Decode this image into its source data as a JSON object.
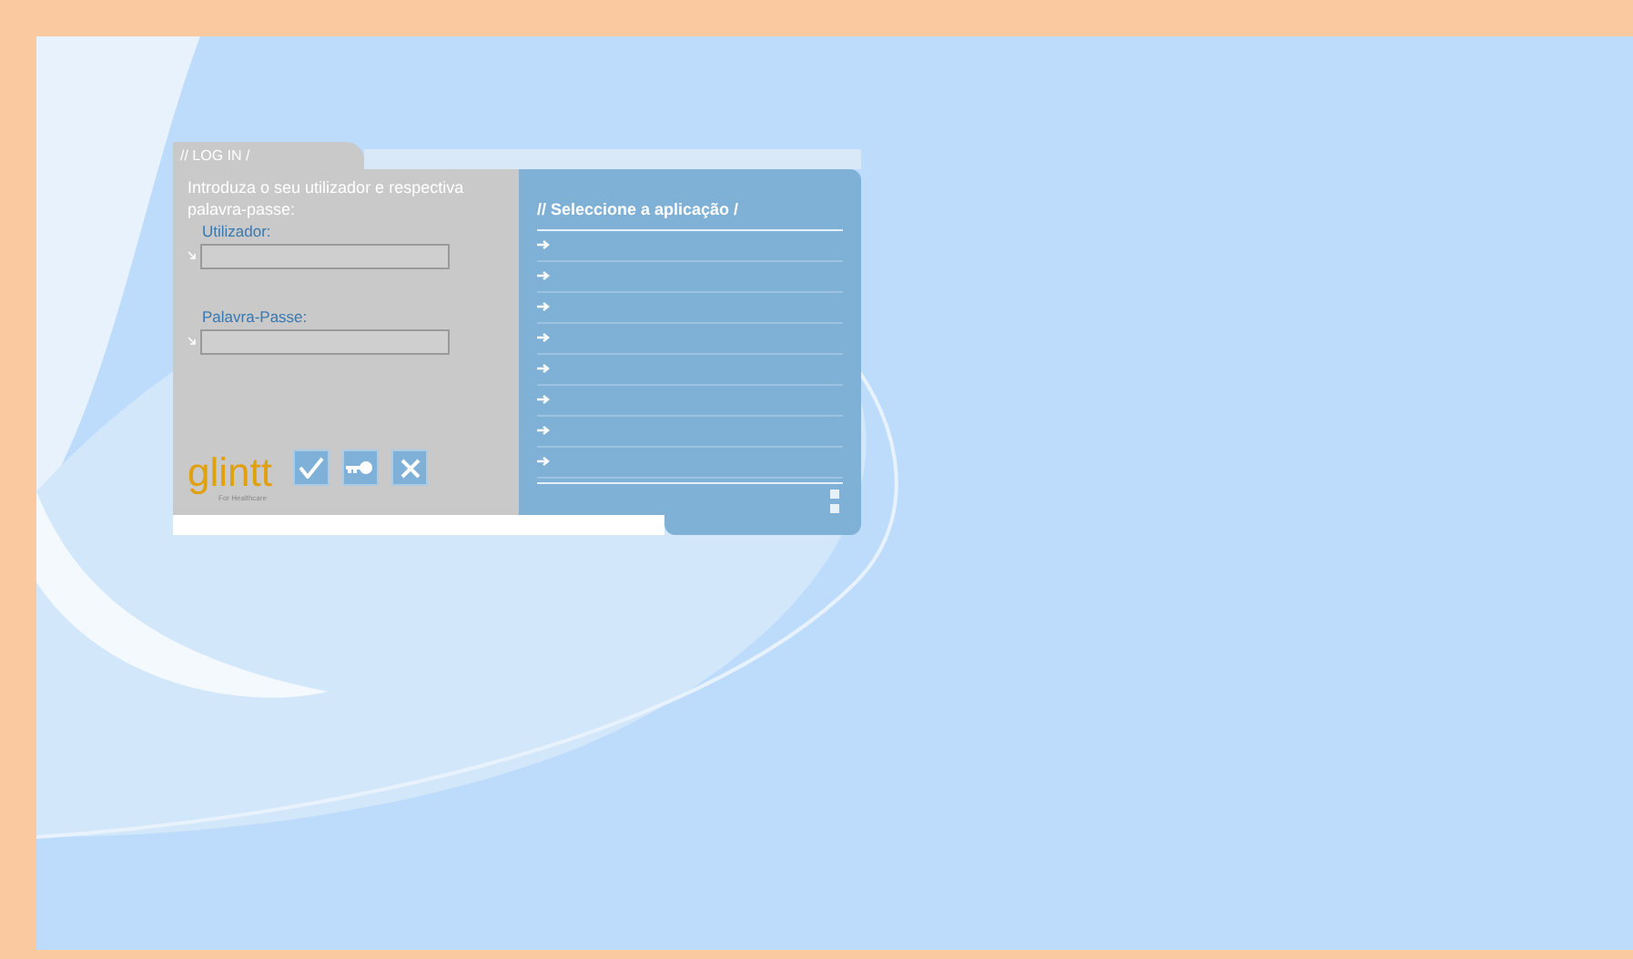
{
  "login": {
    "tab": "// LOG IN /",
    "intro": "Introduza o seu utilizador e respectiva palavra-passe:",
    "fields": [
      {
        "label": "Utilizador:"
      },
      {
        "label": "Palavra-Passe:"
      }
    ],
    "logo": {
      "name": "glintt",
      "tagline": "For Healthcare"
    },
    "buttons": [
      {
        "kind": "confirm"
      },
      {
        "kind": "key"
      },
      {
        "kind": "cancel"
      }
    ]
  },
  "apps": {
    "title": "// Seleccione a aplicação /",
    "rows": [
      {
        "kind": "empty"
      },
      {
        "kind": "empty"
      },
      {
        "kind": "empty"
      },
      {
        "kind": "empty"
      },
      {
        "kind": "empty"
      },
      {
        "kind": "empty"
      },
      {
        "kind": "empty"
      },
      {
        "kind": "empty"
      }
    ]
  }
}
